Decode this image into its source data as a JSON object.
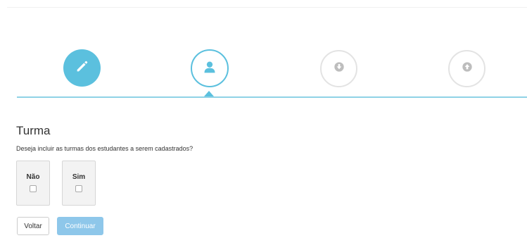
{
  "wizard": {
    "steps": [
      {
        "icon": "pencil-icon",
        "state": "completed"
      },
      {
        "icon": "user-icon",
        "state": "active"
      },
      {
        "icon": "download-circle-icon",
        "state": "pending"
      },
      {
        "icon": "upload-circle-icon",
        "state": "pending"
      }
    ],
    "colors": {
      "accent": "#5bc0de",
      "line": "#8fd2e6",
      "pending_border": "#e3e3e3",
      "pending_icon": "#bdbdbd"
    }
  },
  "section": {
    "title": "Turma",
    "question": "Deseja incluir as turmas dos estudantes a serem cadastrados?"
  },
  "options": [
    {
      "label": "Não",
      "checked": false
    },
    {
      "label": "Sim",
      "checked": false
    }
  ],
  "buttons": {
    "back_label": "Voltar",
    "continue_label": "Continuar",
    "continue_color": "#8ec7ea"
  }
}
